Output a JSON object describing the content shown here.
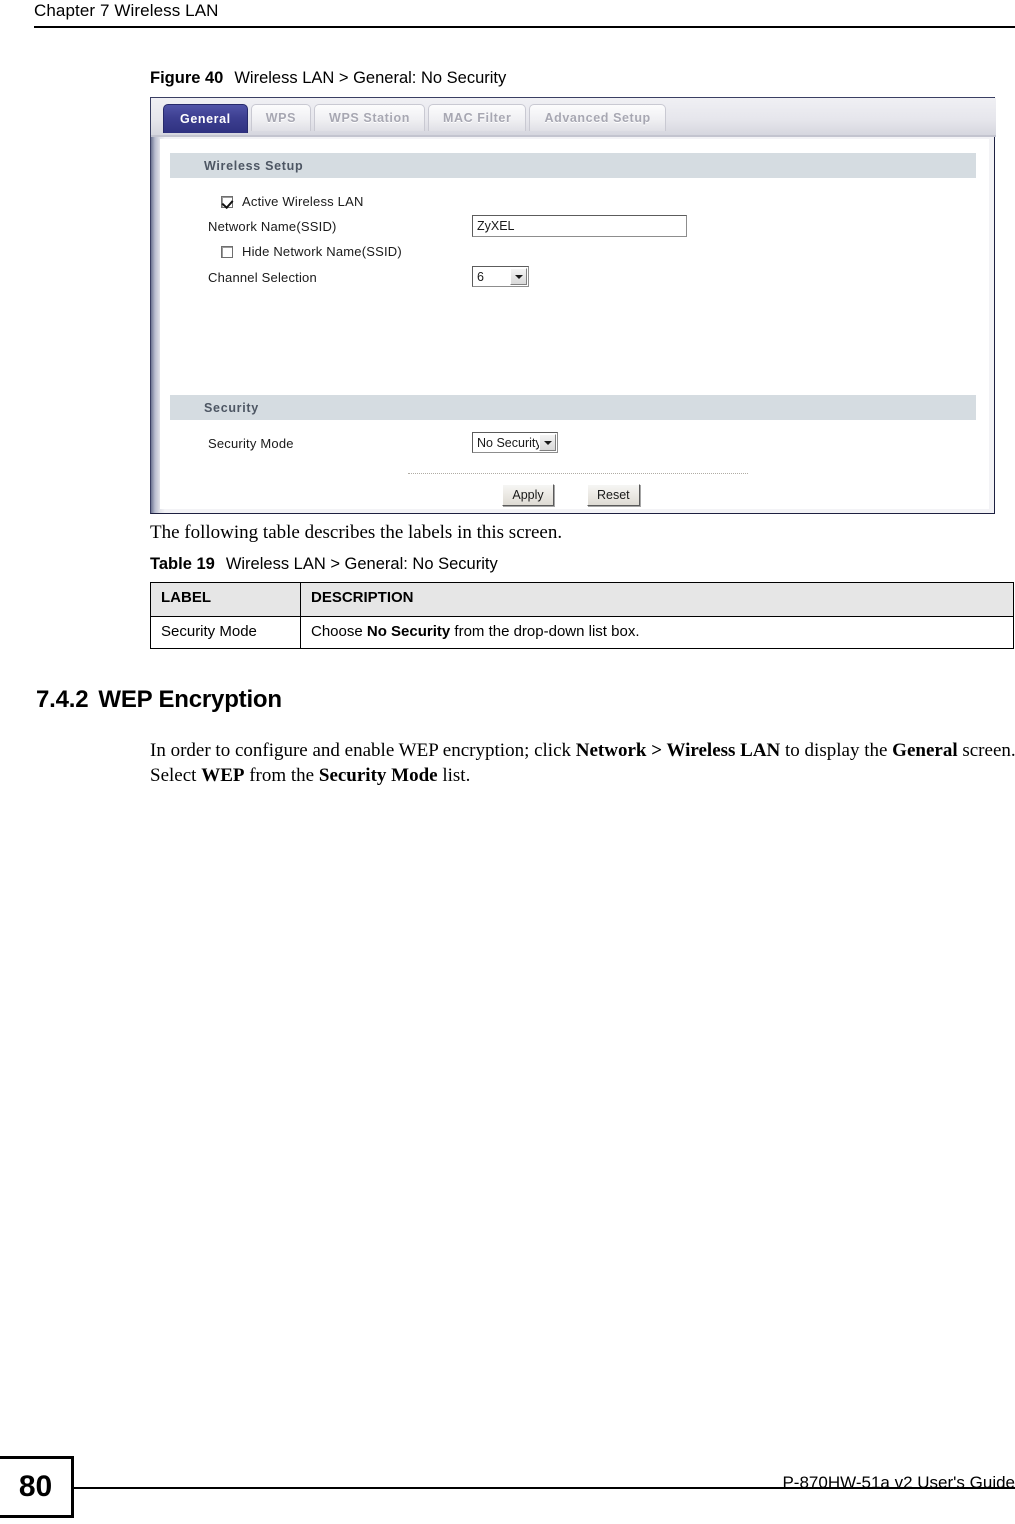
{
  "header": {
    "chapter": "Chapter 7 Wireless LAN"
  },
  "figure": {
    "label": "Figure 40",
    "title": "Wireless LAN > General: No Security"
  },
  "screenshot_ui": {
    "tabs": [
      {
        "label": "General",
        "active": true
      },
      {
        "label": "WPS",
        "active": false
      },
      {
        "label": "WPS Station",
        "active": false
      },
      {
        "label": "MAC Filter",
        "active": false
      },
      {
        "label": "Advanced Setup",
        "active": false
      }
    ],
    "wireless_setup": {
      "section_title": "Wireless Setup",
      "active_wireless_lan": {
        "label": "Active Wireless LAN",
        "checked": true
      },
      "network_name": {
        "label": "Network Name(SSID)",
        "value": "ZyXEL"
      },
      "hide_network_name": {
        "label": "Hide Network Name(SSID)",
        "checked": false
      },
      "channel_selection": {
        "label": "Channel Selection",
        "value": "6"
      }
    },
    "security": {
      "section_title": "Security",
      "security_mode": {
        "label": "Security Mode",
        "value": "No Security"
      }
    },
    "buttons": {
      "apply": "Apply",
      "reset": "Reset"
    }
  },
  "intro_text": "The following table describes the labels in this screen.",
  "table": {
    "caption_label": "Table 19",
    "caption_title": "Wireless LAN > General: No Security",
    "columns": [
      "LABEL",
      "DESCRIPTION"
    ],
    "rows": [
      {
        "label": "Security Mode",
        "description_pre": "Choose ",
        "description_bold": "No Security",
        "description_post": " from the drop-down list box."
      }
    ]
  },
  "section": {
    "number": "7.4.2",
    "title": "WEP Encryption",
    "paragraph": {
      "p1": "In order to configure and enable WEP encryption; click ",
      "b1": "Network > Wireless LAN",
      "p2": " to display the ",
      "b2": "General",
      "p3": " screen. Select ",
      "b3": "WEP",
      "p4": " from the ",
      "b4": "Security Mode",
      "p5": " list."
    }
  },
  "footer": {
    "page_number": "80",
    "guide_name": "P-870HW-51a v2 User's Guide"
  }
}
